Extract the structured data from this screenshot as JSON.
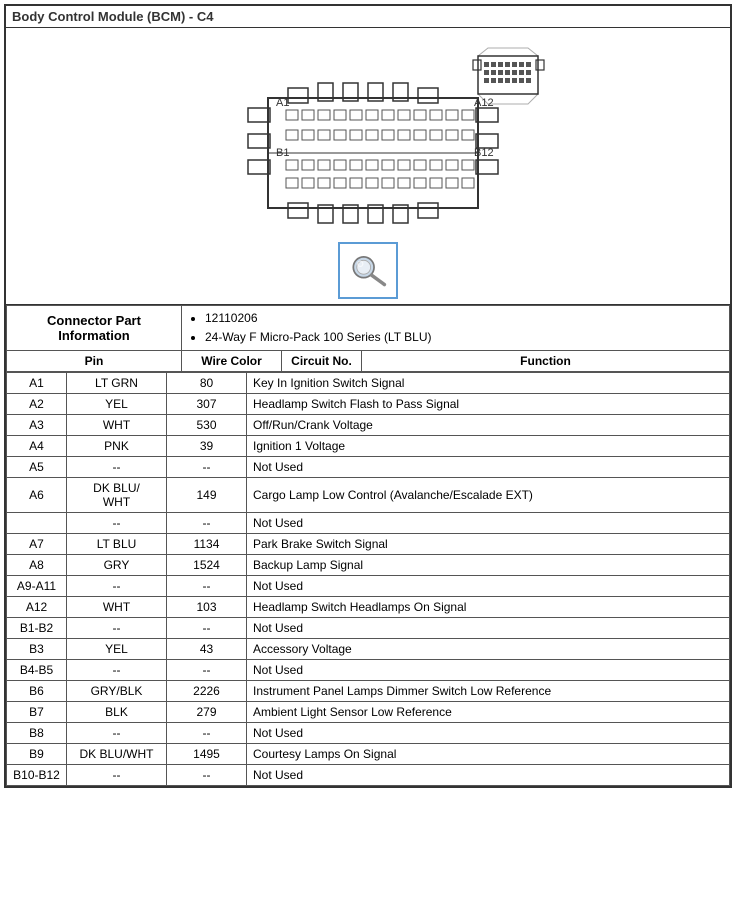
{
  "title": "Body Control Module (BCM) - C4",
  "connector_part_label": "Connector Part Information",
  "part_info": {
    "part_number": "12110206",
    "description": "24-Way F Micro-Pack 100 Series (LT BLU)"
  },
  "table_headers": {
    "pin": "Pin",
    "wire_color": "Wire Color",
    "circuit_no": "Circuit No.",
    "function": "Function"
  },
  "rows": [
    {
      "pin": "A1",
      "wire": "LT GRN",
      "circuit": "80",
      "function": "Key In Ignition Switch Signal"
    },
    {
      "pin": "A2",
      "wire": "YEL",
      "circuit": "307",
      "function": "Headlamp Switch Flash to Pass Signal"
    },
    {
      "pin": "A3",
      "wire": "WHT",
      "circuit": "530",
      "function": "Off/Run/Crank Voltage"
    },
    {
      "pin": "A4",
      "wire": "PNK",
      "circuit": "39",
      "function": "Ignition 1 Voltage"
    },
    {
      "pin": "A5",
      "wire": "--",
      "circuit": "--",
      "function": "Not Used"
    },
    {
      "pin": "A6",
      "wire": "DK BLU/\nWHT",
      "circuit": "149",
      "function": "Cargo Lamp Low Control (Avalanche/Escalade EXT)"
    },
    {
      "pin": "",
      "wire": "--",
      "circuit": "--",
      "function": "Not Used"
    },
    {
      "pin": "A7",
      "wire": "LT BLU",
      "circuit": "1134",
      "function": "Park Brake Switch Signal"
    },
    {
      "pin": "A8",
      "wire": "GRY",
      "circuit": "1524",
      "function": "Backup Lamp Signal"
    },
    {
      "pin": "A9-A11",
      "wire": "--",
      "circuit": "--",
      "function": "Not Used"
    },
    {
      "pin": "A12",
      "wire": "WHT",
      "circuit": "103",
      "function": "Headlamp Switch Headlamps On Signal"
    },
    {
      "pin": "B1-B2",
      "wire": "--",
      "circuit": "--",
      "function": "Not Used"
    },
    {
      "pin": "B3",
      "wire": "YEL",
      "circuit": "43",
      "function": "Accessory Voltage"
    },
    {
      "pin": "B4-B5",
      "wire": "--",
      "circuit": "--",
      "function": "Not Used"
    },
    {
      "pin": "B6",
      "wire": "GRY/BLK",
      "circuit": "2226",
      "function": "Instrument Panel Lamps Dimmer Switch Low Reference"
    },
    {
      "pin": "B7",
      "wire": "BLK",
      "circuit": "279",
      "function": "Ambient Light Sensor Low Reference"
    },
    {
      "pin": "B8",
      "wire": "--",
      "circuit": "--",
      "function": "Not Used"
    },
    {
      "pin": "B9",
      "wire": "DK BLU/WHT",
      "circuit": "1495",
      "function": "Courtesy Lamps On Signal"
    },
    {
      "pin": "B10-B12",
      "wire": "--",
      "circuit": "--",
      "function": "Not Used"
    }
  ]
}
